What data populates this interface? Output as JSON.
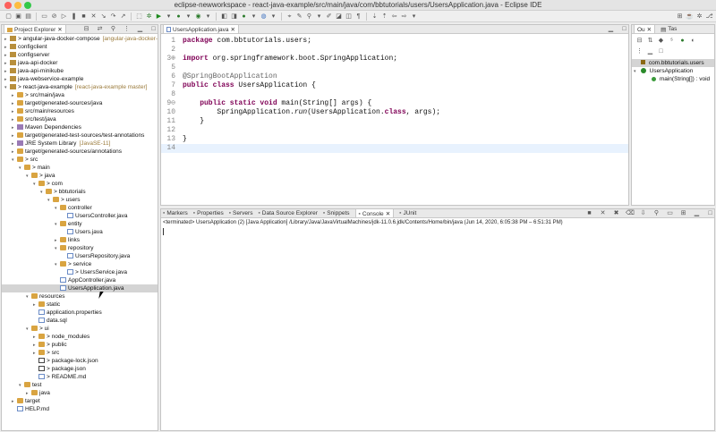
{
  "window": {
    "title": "eclipse-newworkspace - react-java-example/src/main/java/com/bbtutorials/users/UsersApplication.java - Eclipse IDE",
    "traffic_colors": [
      "#fc605c",
      "#fdbc40",
      "#34c84a"
    ]
  },
  "project_explorer": {
    "tab_label": "Project Explorer",
    "items": [
      {
        "label": "> angular-java-docker-compose",
        "deco": "[angular-java-docker-c",
        "depth": 0,
        "icon": "proj",
        "arrow": "▸"
      },
      {
        "label": "configclient",
        "deco": "",
        "depth": 0,
        "icon": "proj",
        "arrow": "▸"
      },
      {
        "label": "configserver",
        "deco": "",
        "depth": 0,
        "icon": "proj",
        "arrow": "▸"
      },
      {
        "label": "java-api-docker",
        "deco": "",
        "depth": 0,
        "icon": "proj",
        "arrow": "▸"
      },
      {
        "label": "java-api-minikube",
        "deco": "",
        "depth": 0,
        "icon": "proj",
        "arrow": "▸"
      },
      {
        "label": "java-webservice-example",
        "deco": "",
        "depth": 0,
        "icon": "proj",
        "arrow": "▸"
      },
      {
        "label": "> react-java-example",
        "deco": "[react-java-example master]",
        "depth": 0,
        "icon": "proj",
        "arrow": "▾"
      },
      {
        "label": "> src/main/java",
        "deco": "",
        "depth": 1,
        "icon": "folder",
        "arrow": "▸"
      },
      {
        "label": "target/generated-sources/java",
        "deco": "",
        "depth": 1,
        "icon": "folder",
        "arrow": "▸"
      },
      {
        "label": "src/main/resources",
        "deco": "",
        "depth": 1,
        "icon": "folder",
        "arrow": "▸"
      },
      {
        "label": "src/test/java",
        "deco": "",
        "depth": 1,
        "icon": "folder",
        "arrow": "▸"
      },
      {
        "label": "Maven Dependencies",
        "deco": "",
        "depth": 1,
        "icon": "lib",
        "arrow": "▸"
      },
      {
        "label": "target/generated-test-sources/test-annotations",
        "deco": "",
        "depth": 1,
        "icon": "folder",
        "arrow": "▸"
      },
      {
        "label": "JRE System Library",
        "deco": "[JavaSE-11]",
        "depth": 1,
        "icon": "lib",
        "arrow": "▸"
      },
      {
        "label": "target/generated-sources/annotations",
        "deco": "",
        "depth": 1,
        "icon": "folder",
        "arrow": "▸"
      },
      {
        "label": "> src",
        "deco": "",
        "depth": 1,
        "icon": "folder",
        "arrow": "▾"
      },
      {
        "label": "> main",
        "deco": "",
        "depth": 2,
        "icon": "folder",
        "arrow": "▾"
      },
      {
        "label": "> java",
        "deco": "",
        "depth": 3,
        "icon": "folder",
        "arrow": "▾"
      },
      {
        "label": "> com",
        "deco": "",
        "depth": 4,
        "icon": "folder",
        "arrow": "▾"
      },
      {
        "label": "> bbtutorials",
        "deco": "",
        "depth": 5,
        "icon": "folder",
        "arrow": "▾"
      },
      {
        "label": "> users",
        "deco": "",
        "depth": 6,
        "icon": "folder",
        "arrow": "▾"
      },
      {
        "label": "controller",
        "deco": "",
        "depth": 7,
        "icon": "folder",
        "arrow": "▾"
      },
      {
        "label": "UsersController.java",
        "deco": "",
        "depth": 8,
        "icon": "javaf",
        "arrow": ""
      },
      {
        "label": "entity",
        "deco": "",
        "depth": 7,
        "icon": "folder",
        "arrow": "▾"
      },
      {
        "label": "Users.java",
        "deco": "",
        "depth": 8,
        "icon": "javaf",
        "arrow": ""
      },
      {
        "label": "links",
        "deco": "",
        "depth": 7,
        "icon": "folder",
        "arrow": "▸"
      },
      {
        "label": "repository",
        "deco": "",
        "depth": 7,
        "icon": "folder",
        "arrow": "▾"
      },
      {
        "label": "UsersRepository.java",
        "deco": "",
        "depth": 8,
        "icon": "javaf",
        "arrow": ""
      },
      {
        "label": "> service",
        "deco": "",
        "depth": 7,
        "icon": "folder",
        "arrow": "▾"
      },
      {
        "label": "> UsersService.java",
        "deco": "",
        "depth": 8,
        "icon": "javaf",
        "arrow": ""
      },
      {
        "label": "AppController.java",
        "deco": "",
        "depth": 7,
        "icon": "javaf",
        "arrow": ""
      },
      {
        "label": "UsersApplication.java",
        "deco": "",
        "depth": 7,
        "icon": "javaf",
        "arrow": "",
        "selected": true
      },
      {
        "label": "resources",
        "deco": "",
        "depth": 3,
        "icon": "folder",
        "arrow": "▾"
      },
      {
        "label": "static",
        "deco": "",
        "depth": 4,
        "icon": "folder",
        "arrow": "▸"
      },
      {
        "label": "application.properties",
        "deco": "",
        "depth": 4,
        "icon": "javaf",
        "arrow": ""
      },
      {
        "label": "data.sql",
        "deco": "",
        "depth": 4,
        "icon": "javaf",
        "arrow": ""
      },
      {
        "label": "> ui",
        "deco": "",
        "depth": 3,
        "icon": "folder",
        "arrow": "▾"
      },
      {
        "label": "> node_modules",
        "deco": "",
        "depth": 4,
        "icon": "folder",
        "arrow": "▸"
      },
      {
        "label": "> public",
        "deco": "",
        "depth": 4,
        "icon": "folder",
        "arrow": "▸"
      },
      {
        "label": "> src",
        "deco": "",
        "depth": 4,
        "icon": "folder",
        "arrow": "▸"
      },
      {
        "label": "> package-lock.json",
        "deco": "",
        "depth": 4,
        "icon": "json",
        "arrow": ""
      },
      {
        "label": "> package.json",
        "deco": "",
        "depth": 4,
        "icon": "json",
        "arrow": ""
      },
      {
        "label": "> README.md",
        "deco": "",
        "depth": 4,
        "icon": "javaf",
        "arrow": ""
      },
      {
        "label": "test",
        "deco": "",
        "depth": 2,
        "icon": "folder",
        "arrow": "▾"
      },
      {
        "label": "java",
        "deco": "",
        "depth": 3,
        "icon": "folder",
        "arrow": "▸"
      },
      {
        "label": "target",
        "deco": "",
        "depth": 1,
        "icon": "folder",
        "arrow": "▸"
      },
      {
        "label": "HELP.md",
        "deco": "",
        "depth": 1,
        "icon": "javaf",
        "arrow": ""
      }
    ]
  },
  "editor": {
    "tab_label": "UsersApplication.java",
    "lines": [
      {
        "n": "1",
        "parts": [
          {
            "t": "package",
            "c": "kw"
          },
          {
            "t": " com.bbtutorials.users;",
            "c": ""
          }
        ]
      },
      {
        "n": "2",
        "parts": []
      },
      {
        "n": "3⊕",
        "parts": [
          {
            "t": "import",
            "c": "kw"
          },
          {
            "t": " org.springframework.boot.SpringApplication;",
            "c": ""
          }
        ]
      },
      {
        "n": "5",
        "parts": []
      },
      {
        "n": "6",
        "parts": [
          {
            "t": "@SpringBootApplication",
            "c": "ann"
          }
        ]
      },
      {
        "n": "7",
        "parts": [
          {
            "t": "public class",
            "c": "kw"
          },
          {
            "t": " UsersApplication {",
            "c": ""
          }
        ]
      },
      {
        "n": "8",
        "parts": []
      },
      {
        "n": "9⊖",
        "parts": [
          {
            "t": "    public static void",
            "c": "kw"
          },
          {
            "t": " main(String[] args) {",
            "c": ""
          }
        ]
      },
      {
        "n": "10",
        "parts": [
          {
            "t": "        SpringApplication.",
            "c": ""
          },
          {
            "t": "run",
            "c": "it"
          },
          {
            "t": "(UsersApplication.",
            "c": ""
          },
          {
            "t": "class",
            "c": "kw"
          },
          {
            "t": ", args);",
            "c": ""
          }
        ]
      },
      {
        "n": "11",
        "parts": [
          {
            "t": "    }",
            "c": ""
          }
        ]
      },
      {
        "n": "12",
        "parts": []
      },
      {
        "n": "13",
        "parts": [
          {
            "t": "}",
            "c": ""
          }
        ]
      },
      {
        "n": "14",
        "parts": [],
        "current": true
      }
    ]
  },
  "outline": {
    "tabs": [
      "Ou",
      "Tas"
    ],
    "package": "com.bbtutorials.users",
    "class": "UsersApplication",
    "method": "main(String[]) : void"
  },
  "bottom": {
    "tabs": [
      "Markers",
      "Properties",
      "Servers",
      "Data Source Explorer",
      "Snippets",
      "Console",
      "JUnit"
    ],
    "active_tab": "Console",
    "console_text": "<terminated> UsersApplication (2) [Java Application] /Library/Java/JavaVirtualMachines/jdk-11.0.6.jdk/Contents/Home/bin/java  (Jun 14, 2020, 6:05:38 PM – 6:51:31 PM)"
  }
}
